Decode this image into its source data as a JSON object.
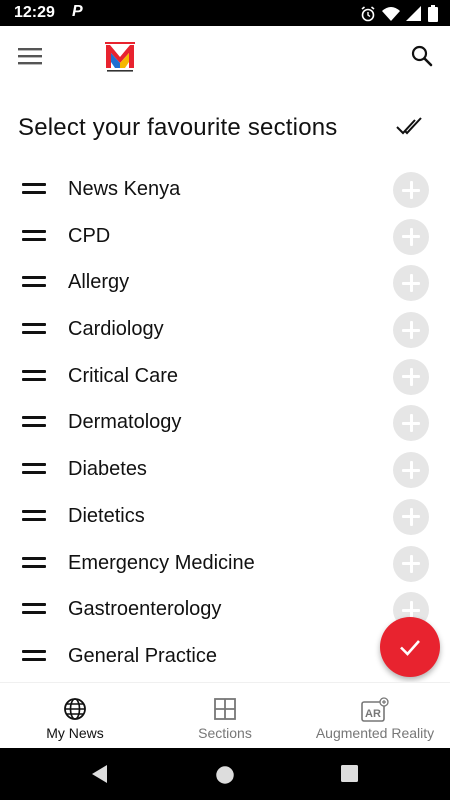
{
  "status_bar": {
    "time": "12:29",
    "notification_letter": "P",
    "icons": [
      "alarm-icon",
      "wifi-icon",
      "signal-icon",
      "battery-icon"
    ]
  },
  "app_bar": {
    "menu_icon": "menu-icon",
    "logo_icon": "medical-m-logo-icon",
    "search_icon": "search-icon"
  },
  "header": {
    "title": "Select your favourite sections",
    "action_icon": "done-all-icon"
  },
  "sections": [
    {
      "label": "News Kenya"
    },
    {
      "label": "CPD"
    },
    {
      "label": "Allergy"
    },
    {
      "label": "Cardiology"
    },
    {
      "label": "Critical Care"
    },
    {
      "label": "Dermatology"
    },
    {
      "label": "Diabetes"
    },
    {
      "label": "Dietetics"
    },
    {
      "label": "Emergency Medicine"
    },
    {
      "label": "Gastroenterology"
    },
    {
      "label": "General Practice"
    }
  ],
  "fab": {
    "icon": "check-icon",
    "color": "#e8232f"
  },
  "bottom_nav": {
    "items": [
      {
        "label": "My News",
        "icon": "globe-icon",
        "active": true
      },
      {
        "label": "Sections",
        "icon": "grid-icon",
        "active": false
      },
      {
        "label": "Augmented Reality",
        "icon": "ar-icon",
        "active": false
      }
    ]
  },
  "system_nav": {
    "icons": [
      "back-icon",
      "home-icon",
      "recents-icon"
    ]
  },
  "colors": {
    "accent": "#e8232f",
    "add_button": "#e6e6e6",
    "text": "#111111"
  }
}
